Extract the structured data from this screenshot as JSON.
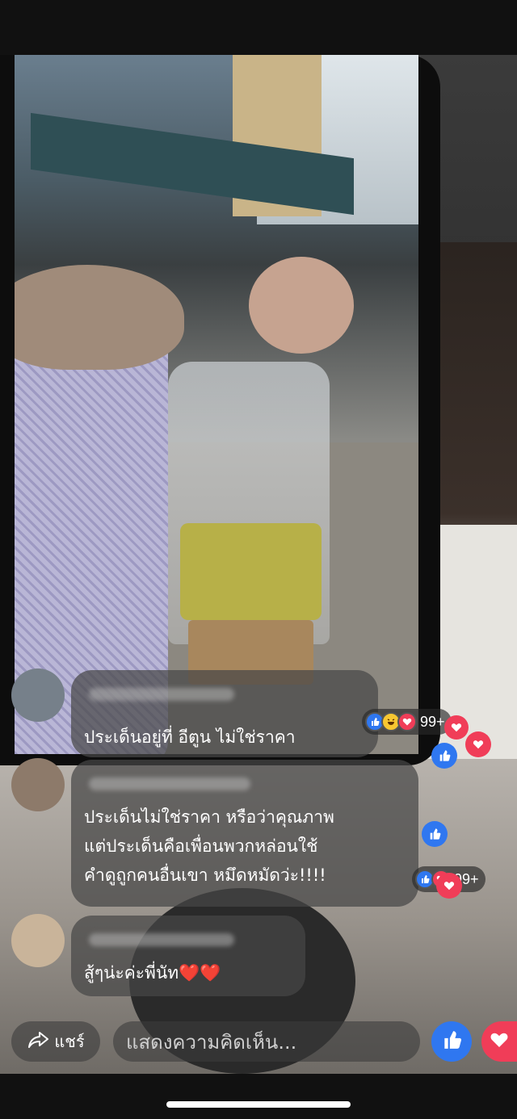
{
  "comments": [
    {
      "text": "ประเด็นอยู่ที่ อีตูน ไม่ใช่ราคา",
      "reactions": {
        "icons": [
          "like-icon",
          "haha-icon",
          "love-icon"
        ],
        "count": "99+"
      }
    },
    {
      "lines": [
        "ประเด็นไม่ใช่ราคา หรือว่าคุณภาพ",
        "แต่ประเด็นคือเพื่อนพวกหล่อนใช้",
        "คำดูถูกคนอื่นเขา หมึดหมัดว่ะ!!!!"
      ],
      "reactions": {
        "icons": [
          "like-icon",
          "love-icon"
        ],
        "count": "99+"
      }
    },
    {
      "text": "สู้ๆน่ะค่ะพี่นัท❤️❤️"
    }
  ],
  "bottom_bar": {
    "share_label": "แชร์",
    "comment_placeholder": "แสดงความคิดเห็น..."
  },
  "colors": {
    "like": "#2f77f0",
    "love": "#f03d58",
    "haha": "#f7c631"
  }
}
